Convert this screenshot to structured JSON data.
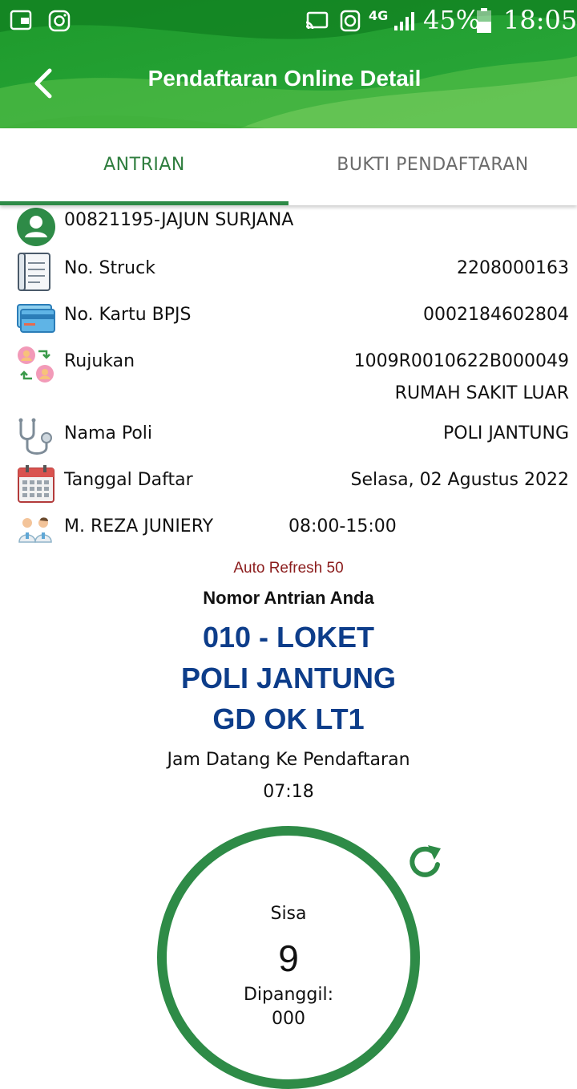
{
  "status_bar": {
    "battery": "45%",
    "time": "18:05",
    "network": "4G"
  },
  "appbar": {
    "title": "Pendaftaran Online Detail",
    "back_icon": "arrow-back-icon"
  },
  "tabs": [
    {
      "label": "ANTRIAN",
      "active": true
    },
    {
      "label": "BUKTI PENDAFTARAN",
      "active": false
    }
  ],
  "patient": {
    "name": "00821195-JAJUN SURJANA",
    "icon": "user-avatar-icon"
  },
  "details": {
    "struck": {
      "label": "No. Struck",
      "value": "2208000163",
      "icon": "receipt-icon"
    },
    "bpjs": {
      "label": "No. Kartu BPJS",
      "value": "0002184602804",
      "icon": "card-icon"
    },
    "rujukan": {
      "label": "Rujukan",
      "value": "1009R0010622B000049",
      "sub_value": "RUMAH SAKIT LUAR",
      "icon": "referral-icon"
    },
    "poli": {
      "label": "Nama Poli",
      "value": "POLI JANTUNG",
      "icon": "stethoscope-icon"
    },
    "tanggal": {
      "label": "Tanggal Daftar",
      "value": "Selasa, 02 Agustus 2022",
      "icon": "calendar-icon"
    },
    "dokter": {
      "label": "M. REZA JUNIERY",
      "value": "08:00-15:00",
      "icon": "doctors-icon"
    }
  },
  "queue": {
    "auto_refresh": "Auto Refresh 50",
    "title": "Nomor Antrian Anda",
    "line1": "010 - LOKET",
    "line2": "POLI JANTUNG",
    "line3": "GD OK LT1",
    "arrival_label": "Jam Datang Ke Pendaftaran",
    "arrival_time": "07:18",
    "remaining_label": "Sisa",
    "remaining_value": "9",
    "called_label": "Dipanggil:",
    "called_value": "000"
  },
  "colors": {
    "primary_green": "#2e8b47",
    "queue_blue": "#0d3d8a",
    "refresh_red": "#8b1c1c"
  }
}
